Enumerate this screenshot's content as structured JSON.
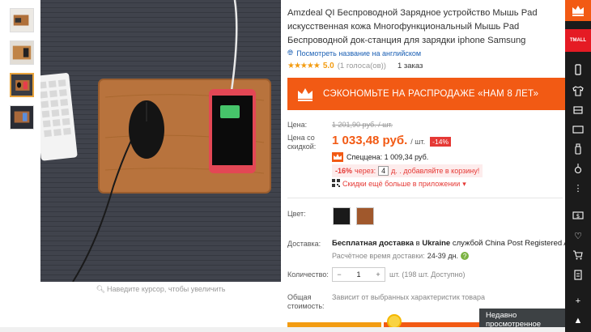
{
  "product": {
    "title": "Amzdeal QI Беспроводной Зарядное устройство Мышь Pad искусственная кожа Многофункциональный Мышь Pad Беспроводной док-станция для зарядки iphone Samsung",
    "translate_link": "Посмотреть название на английском",
    "rating_stars": "★★★★★",
    "rating_value": "5.0",
    "rating_votes": "(1 голоса(ов))",
    "orders": "1 заказ",
    "zoom_hint": "Наведите курсор, чтобы увеличить"
  },
  "promo": {
    "banner_text": "СЭКОНОМЬТЕ НА РАСПРОДАЖЕ «НАМ 8 ЛЕТ»"
  },
  "pricing": {
    "price_label": "Цена:",
    "old_price": "1 201,90 руб. / шт.",
    "discount_label_1": "Цена со",
    "discount_label_2": "скидкой:",
    "price": "1 033,48 руб.",
    "unit": "/ шт.",
    "discount": "-14%",
    "special_price": "Спеццена: 1 009,34 руб.",
    "cart_pct": "-16%",
    "cart_through": "через:",
    "cart_days": "4",
    "cart_rest": "д. . добавляйте в корзину!",
    "app_link": "Скидки ещё больше в приложении"
  },
  "options": {
    "color_label": "Цвет:",
    "delivery_label": "Доставка:",
    "delivery_free": "Бесплатная доставка",
    "delivery_in": " в ",
    "delivery_country": "Ukraine",
    "delivery_service": " службой China Post Registered Air Mail",
    "delivery_time_label": "Расчётное время доставки:",
    "delivery_time": "24-39 дн.",
    "qty_label": "Количество:",
    "qty_minus": "−",
    "qty_value": "1",
    "qty_plus": "+",
    "qty_available": "шт. (198 шт. Доступно)",
    "total_label_1": "Общая",
    "total_label_2": "стоимость:",
    "total_note": "Зависит от выбранных характеристик товара"
  },
  "recent_viewed": "Недавно просмотренное",
  "sidebar": {
    "tmall": "TMALL"
  },
  "colors": {
    "accent": "#f25a14",
    "price": "#f25a14",
    "sidebar": "#1b1b1b"
  }
}
